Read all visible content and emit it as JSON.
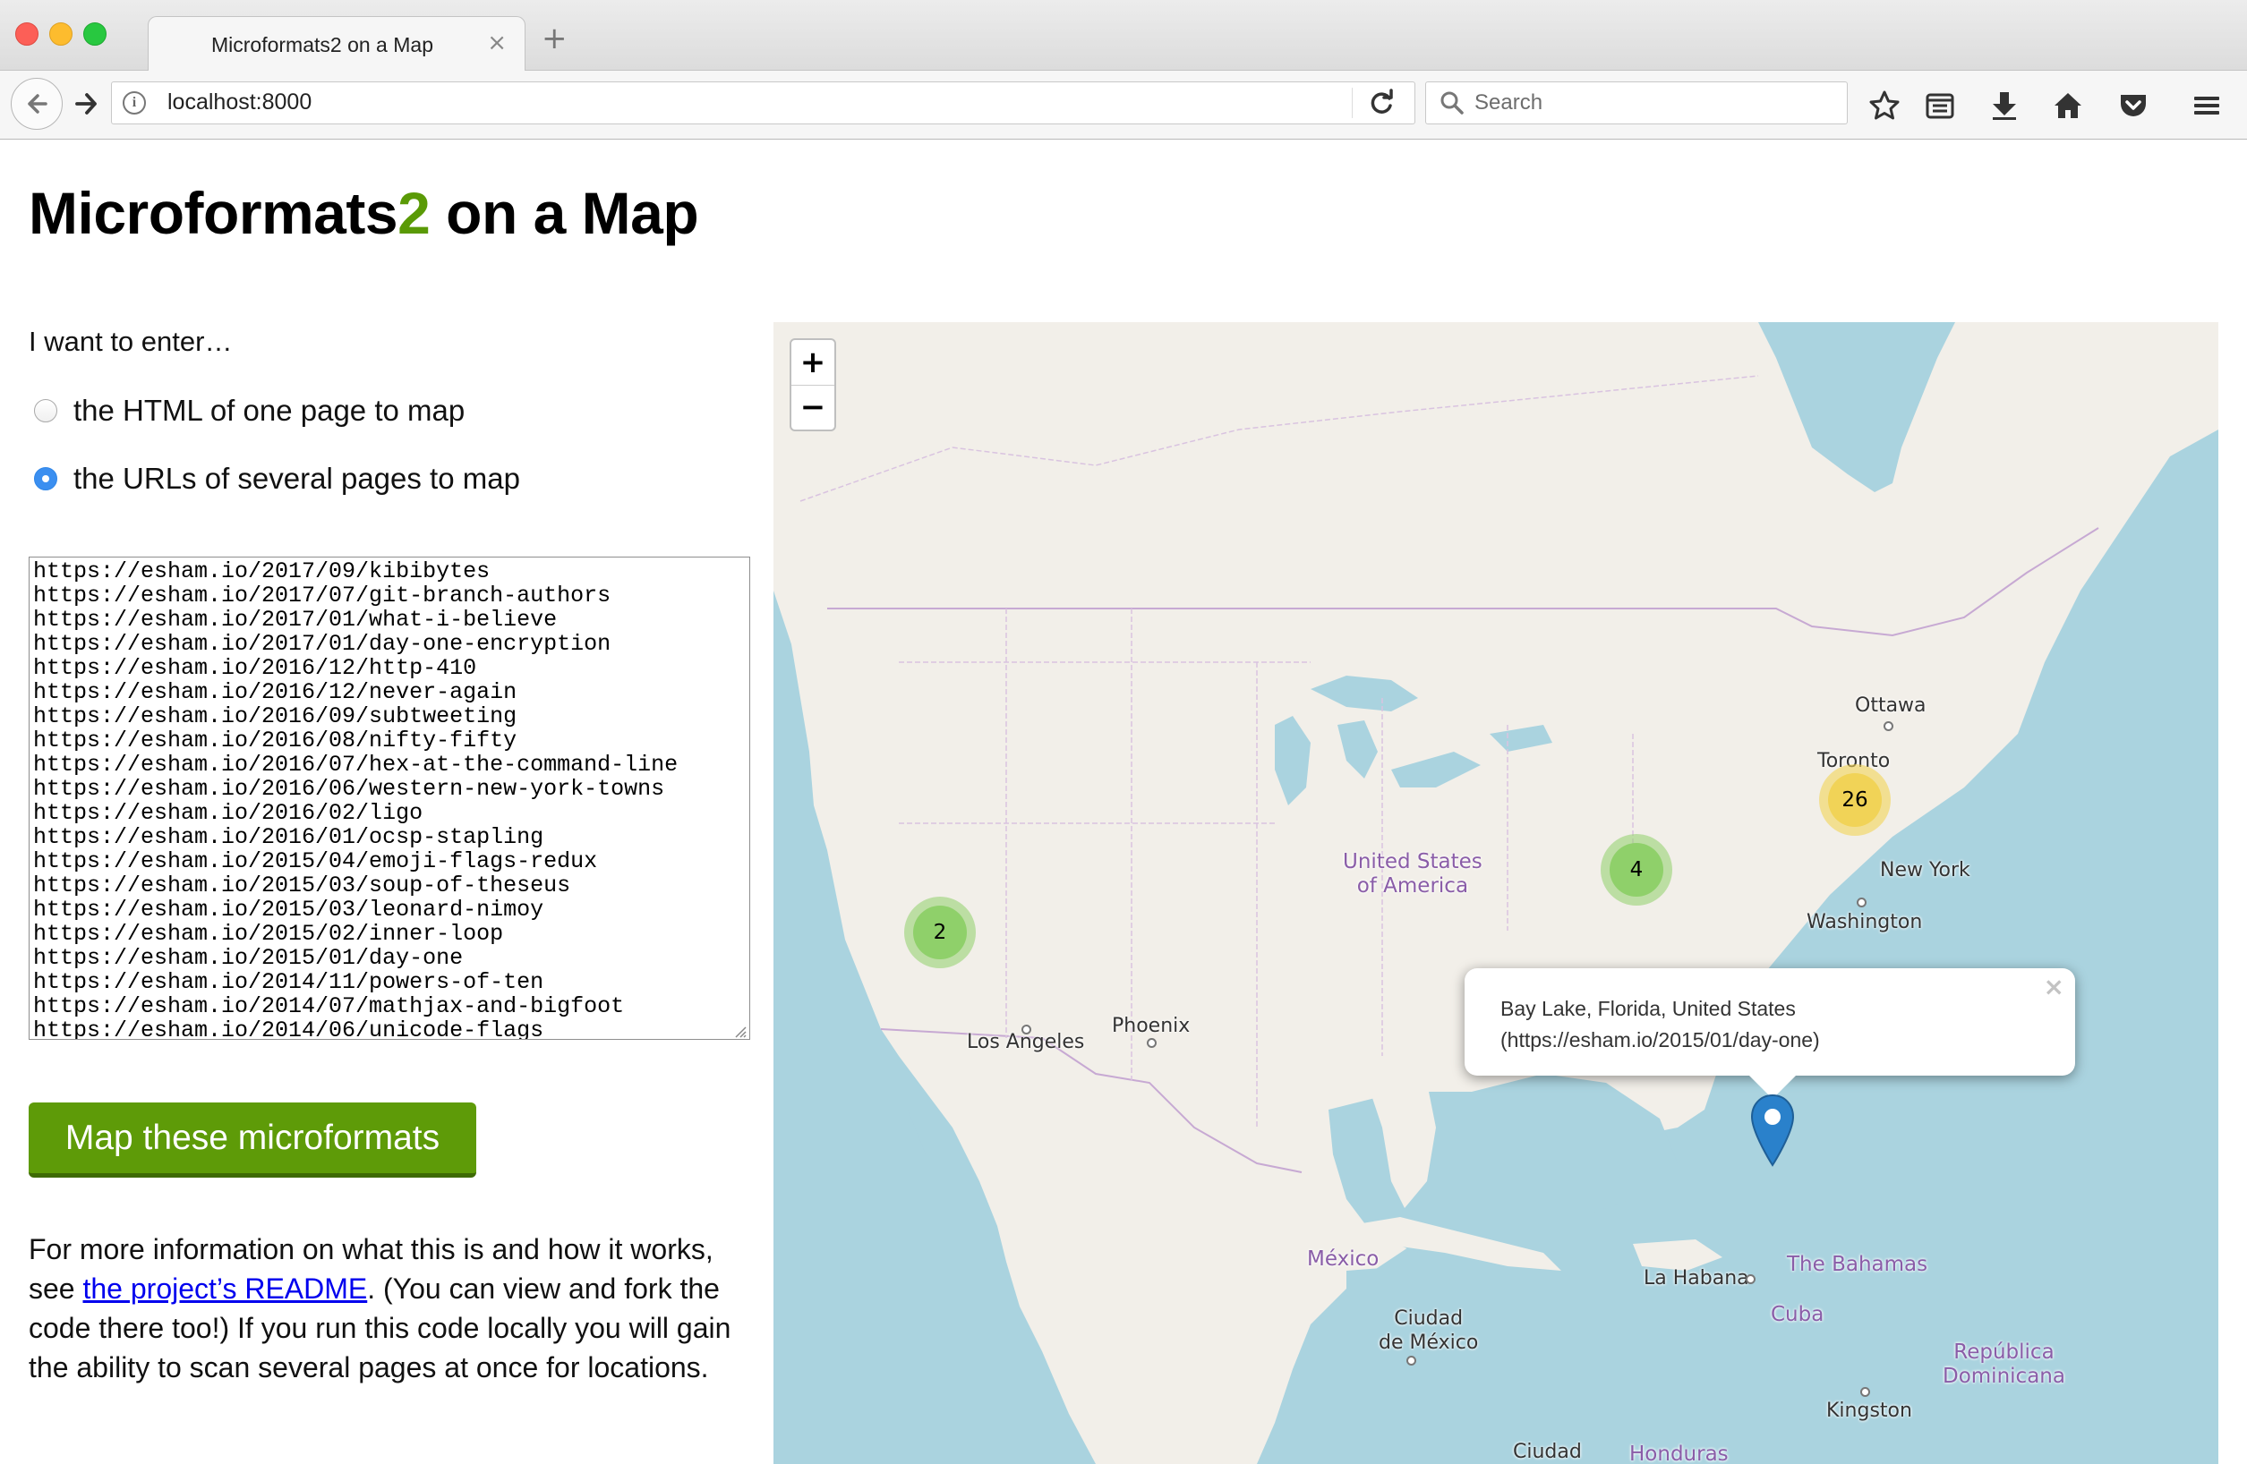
{
  "browser": {
    "tab_title": "Microformats2 on a Map",
    "tab_close": "×",
    "new_tab": "+",
    "url": "localhost:8000",
    "search_placeholder": "Search",
    "icons": [
      "back-icon",
      "forward-icon",
      "info-icon",
      "reload-icon",
      "search-icon",
      "bookmark-star-icon",
      "reading-list-icon",
      "download-icon",
      "home-icon",
      "pocket-icon",
      "menu-icon"
    ]
  },
  "page": {
    "title_part1": "Microformats",
    "title_part2": "2",
    "title_part3": " on a Map",
    "title_accent_color": "#5a9a06",
    "prompt": "I want to enter…",
    "options": [
      {
        "label": "the HTML of one page to map",
        "selected": false
      },
      {
        "label": "the URLs of several pages to map",
        "selected": true
      }
    ],
    "urls": "https://esham.io/2017/09/kibibytes\nhttps://esham.io/2017/07/git-branch-authors\nhttps://esham.io/2017/01/what-i-believe\nhttps://esham.io/2017/01/day-one-encryption\nhttps://esham.io/2016/12/http-410\nhttps://esham.io/2016/12/never-again\nhttps://esham.io/2016/09/subtweeting\nhttps://esham.io/2016/08/nifty-fifty\nhttps://esham.io/2016/07/hex-at-the-command-line\nhttps://esham.io/2016/06/western-new-york-towns\nhttps://esham.io/2016/02/ligo\nhttps://esham.io/2016/01/ocsp-stapling\nhttps://esham.io/2015/04/emoji-flags-redux\nhttps://esham.io/2015/03/soup-of-theseus\nhttps://esham.io/2015/03/leonard-nimoy\nhttps://esham.io/2015/02/inner-loop\nhttps://esham.io/2015/01/day-one\nhttps://esham.io/2014/11/powers-of-ten\nhttps://esham.io/2014/07/mathjax-and-bigfoot\nhttps://esham.io/2014/06/unicode-flags",
    "button_label": "Map these microformats",
    "button_color": "#5e9b08",
    "info_before_link": "For more information on what this is and how it works, see ",
    "info_link": "the project’s README",
    "info_after_link": ". (You can view and fork the code there too!) If you run this code locally you will gain the ability to scan several pages at once for locations."
  },
  "map": {
    "zoom_in": "+",
    "zoom_out": "−",
    "labels": {
      "ottawa": "Ottawa",
      "toronto": "Toronto",
      "new_york": "New York",
      "washington": "Washington",
      "usa_line1": "United States",
      "usa_line2": "of America",
      "los_angeles": "Los Angeles",
      "phoenix": "Phoenix",
      "mexico": "México",
      "ciudad_mexico_line1": "Ciudad",
      "ciudad_mexico_line2": "de México",
      "la_habana": "La Habana",
      "bahamas": "The Bahamas",
      "cuba": "Cuba",
      "republica_line1": "República",
      "republica_line2": "Dominicana",
      "kingston": "Kingston",
      "ciudad_bottom": "Ciudad",
      "honduras": "Honduras"
    },
    "clusters": [
      {
        "name": "cluster-west",
        "count": "2",
        "color": "#8fd06a"
      },
      {
        "name": "cluster-midwest",
        "count": "4",
        "color": "#8fd06a"
      },
      {
        "name": "cluster-northeast",
        "count": "26",
        "color": "#f1d357"
      }
    ],
    "popup_text": "Bay Lake, Florida, United States (https://esham.io/2015/01/day-one)",
    "popup_close": "×",
    "marker_color": "#2a81cb"
  }
}
